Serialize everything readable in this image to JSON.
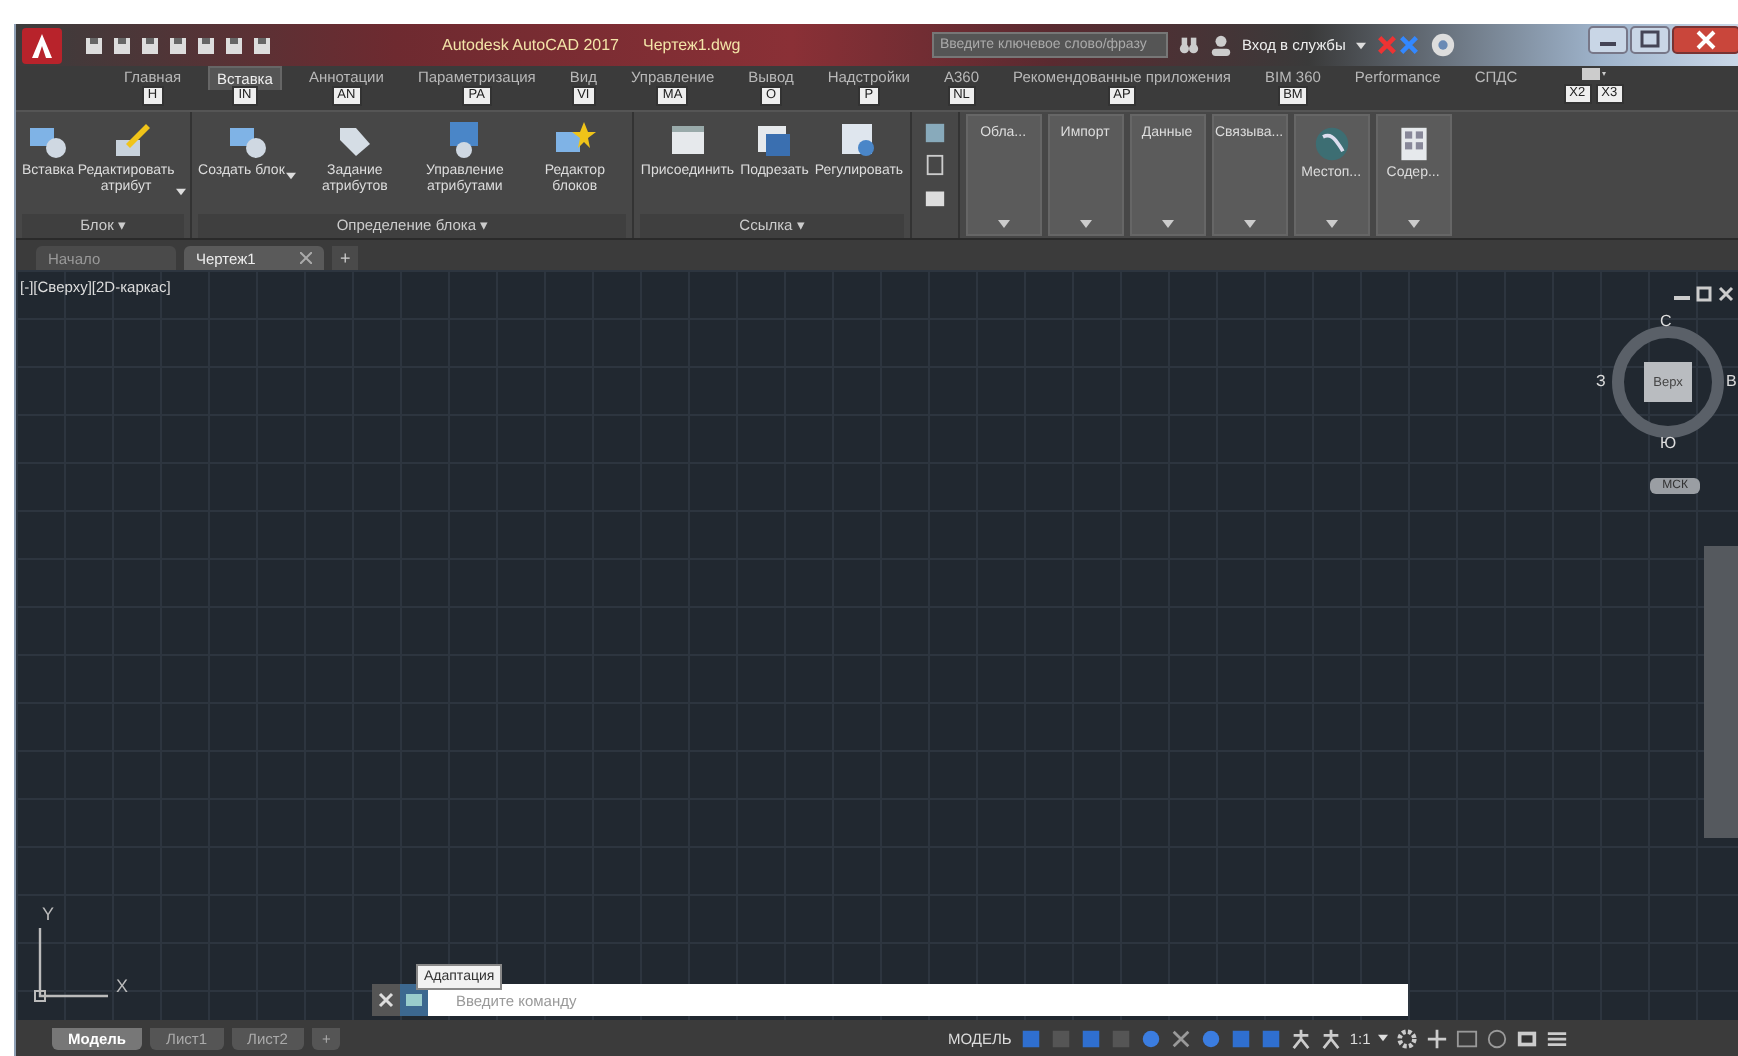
{
  "title_bar": {
    "title": "Autodesk AutoCAD 2017",
    "file": "Чертеж1.dwg",
    "search": {
      "placeholder": "Введите ключевое слово/фразу"
    },
    "sign_in": "Вход в службы"
  },
  "ribbon_tabs": [
    {
      "label": "Главная",
      "keytip": "H",
      "selected": false
    },
    {
      "label": "Вставка",
      "keytip": "IN",
      "selected": true
    },
    {
      "label": "Аннотации",
      "keytip": "AN",
      "selected": false
    },
    {
      "label": "Параметризация",
      "keytip": "PA",
      "selected": false
    },
    {
      "label": "Вид",
      "keytip": "VI",
      "selected": false
    },
    {
      "label": "Управление",
      "keytip": "MA",
      "selected": false
    },
    {
      "label": "Вывод",
      "keytip": "O",
      "selected": false
    },
    {
      "label": "Надстройки",
      "keytip": "P",
      "selected": false
    },
    {
      "label": "A360",
      "keytip": "NL",
      "selected": false
    },
    {
      "label": "Рекомендованные приложения",
      "keytip": "AP",
      "selected": false
    },
    {
      "label": "BIM 360",
      "keytip": "BM",
      "selected": false
    },
    {
      "label": "Performance",
      "selected": false
    },
    {
      "label": "СПДС",
      "selected": false
    }
  ],
  "extra_keytips": [
    "X2",
    "X3"
  ],
  "panels": [
    {
      "title": "Блок ▾",
      "tools": [
        {
          "label": "Вставка",
          "kind": "blocks",
          "dropdown": false
        },
        {
          "label": "Редактировать атрибут",
          "kind": "pencil",
          "dropdown": true
        }
      ]
    },
    {
      "title": "Определение блока ▾",
      "tools": [
        {
          "label": "Создать блок",
          "kind": "create",
          "dropdown": true
        },
        {
          "label": "Задание атрибутов",
          "kind": "tag",
          "dropdown": false
        },
        {
          "label": "Управление атрибутами",
          "kind": "window",
          "dropdown": false
        },
        {
          "label": "Редактор блоков",
          "kind": "star",
          "dropdown": false
        }
      ]
    },
    {
      "title": "Ссылка ▾",
      "tools": [
        {
          "label": "Присоединить",
          "kind": "doc",
          "dropdown": false
        },
        {
          "label": "Подрезать",
          "kind": "clip",
          "dropdown": false
        },
        {
          "label": "Регулировать",
          "kind": "image",
          "dropdown": false
        }
      ]
    }
  ],
  "collapsed_panels": [
    {
      "label": "Обла...",
      "kind": "text"
    },
    {
      "label": "Импорт",
      "kind": "text"
    },
    {
      "label": "Данные",
      "kind": "text"
    },
    {
      "label": "Связыва...",
      "kind": "text"
    },
    {
      "label": "Местоп...",
      "kind": "globe"
    },
    {
      "label": "Содер...",
      "kind": "grid"
    }
  ],
  "file_tabs": [
    {
      "label": "Начало",
      "selected": false,
      "closable": false
    },
    {
      "label": "Чертеж1",
      "selected": true,
      "closable": true
    }
  ],
  "new_tab": "+",
  "viewport": {
    "label": "[-][Сверху][2D-каркас]",
    "viewcube": {
      "top": "Верх",
      "north": "С",
      "east": "В",
      "south": "Ю",
      "west": "З",
      "ucs": "МСК"
    },
    "ucs_icon": {
      "y": "Y",
      "x": "X"
    }
  },
  "command_line": {
    "placeholder": "Введите команду",
    "tooltip": "Адаптация"
  },
  "layout_tabs": [
    {
      "label": "Модель",
      "selected": true
    },
    {
      "label": "Лист1",
      "selected": false
    },
    {
      "label": "Лист2",
      "selected": false
    }
  ],
  "add_layout": "+",
  "status_bar": {
    "mode": "МОДЕЛЬ",
    "scale": "1:1",
    "toggles": [
      {
        "kind": "grid",
        "on": true
      },
      {
        "kind": "snap",
        "on": false
      },
      {
        "kind": "infer",
        "on": true
      },
      {
        "kind": "ortho",
        "on": false
      },
      {
        "kind": "polar",
        "on": true
      },
      {
        "kind": "isodraft",
        "on": false
      },
      {
        "kind": "osnap",
        "on": true
      },
      {
        "kind": "track",
        "on": true
      },
      {
        "kind": "annotate",
        "on": true
      },
      {
        "kind": "person",
        "on": false
      },
      {
        "kind": "person",
        "on": false
      }
    ]
  }
}
